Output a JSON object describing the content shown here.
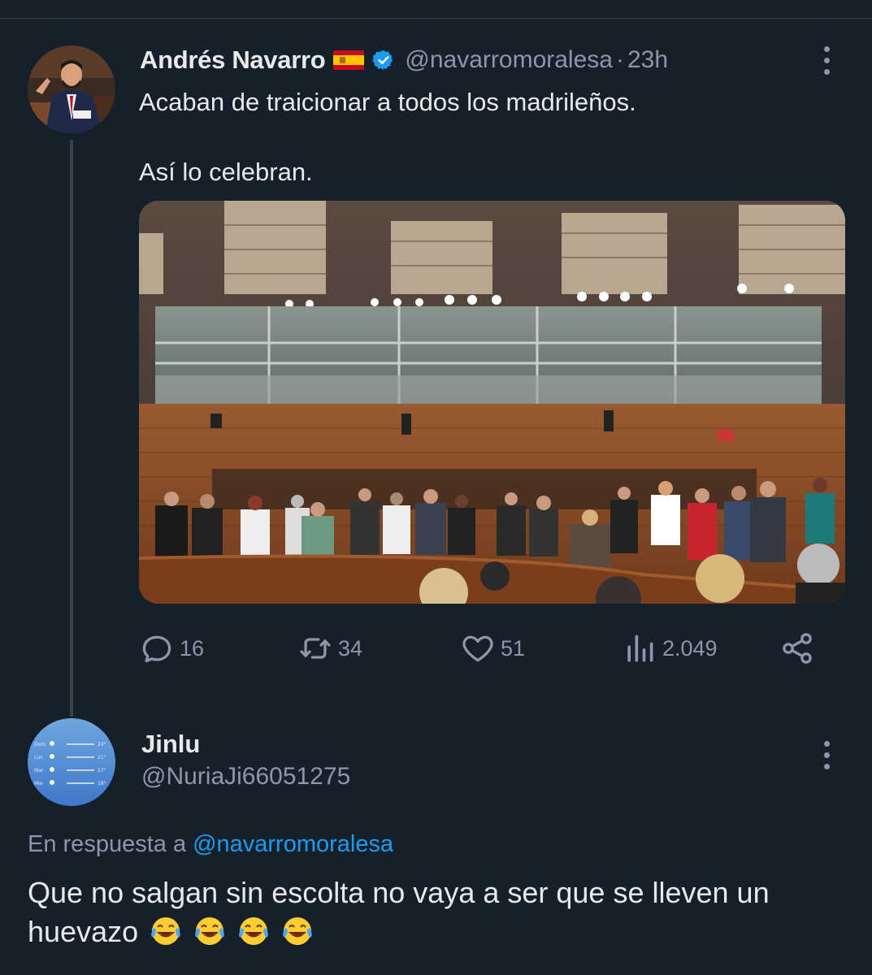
{
  "tweet": {
    "author_name": "Andrés Navarro",
    "author_handle": "@navarromoralesa",
    "separator": "·",
    "time": "23h",
    "text_line1": "Acaban de traicionar a todos los madrileños.",
    "text_line2": "Así lo celebran.",
    "stats": {
      "replies": "16",
      "retweets": "34",
      "likes": "51",
      "views": "2.049"
    }
  },
  "reply": {
    "author_name": "Jinlu",
    "author_handle": "@NuriaJi66051275",
    "replying_prefix": "En respuesta a",
    "replying_to": "@navarromoralesa",
    "text": "Que no salgan sin escolta no vaya a ser que se lleven un huevazo",
    "emoji_count": 4
  },
  "icons": [
    "flag-spain-icon",
    "verified-badge-icon",
    "more-options-icon",
    "reply-icon",
    "retweet-icon",
    "like-icon",
    "views-icon",
    "share-icon",
    "face-with-tears-of-joy-icon"
  ],
  "colors": {
    "background": "#15202b",
    "text": "#e7e9ea",
    "muted": "#8b98a5",
    "accent": "#1d9bf0",
    "thread_line": "#38444d"
  }
}
